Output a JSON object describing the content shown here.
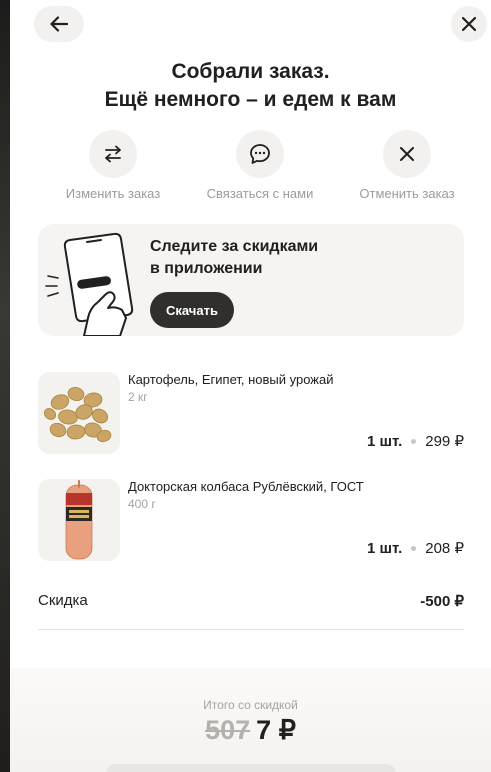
{
  "header": {
    "back_icon": "arrow-left-icon",
    "close_icon": "close-icon",
    "title_line1": "Собрали заказ.",
    "title_line2": "Ещё немного – и едем к вам"
  },
  "actions": [
    {
      "label": "Изменить заказ",
      "icon": "swap-arrows-icon"
    },
    {
      "label": "Связаться с нами",
      "icon": "chat-bubble-icon"
    },
    {
      "label": "Отменить заказ",
      "icon": "close-icon"
    }
  ],
  "promo": {
    "line1": "Следите за скидками",
    "line2": "в приложении",
    "button_label": "Скачать"
  },
  "items": [
    {
      "name": "Картофель, Египет, новый урожай",
      "weight": "2 кг",
      "qty": "1 шт.",
      "price": "299 ₽"
    },
    {
      "name": "Докторская колбаса Рублёвский, ГОСТ",
      "weight": "400 г",
      "qty": "1 шт.",
      "price": "208 ₽"
    }
  ],
  "discount": {
    "label": "Скидка",
    "value": "-500 ₽"
  },
  "total": {
    "label": "Итого со скидкой",
    "old": "507",
    "new": "7 ₽"
  },
  "colors": {
    "dark_button": "#302f2d",
    "muted_text": "#9e9b98",
    "chip_bg": "#f2f1ef"
  }
}
